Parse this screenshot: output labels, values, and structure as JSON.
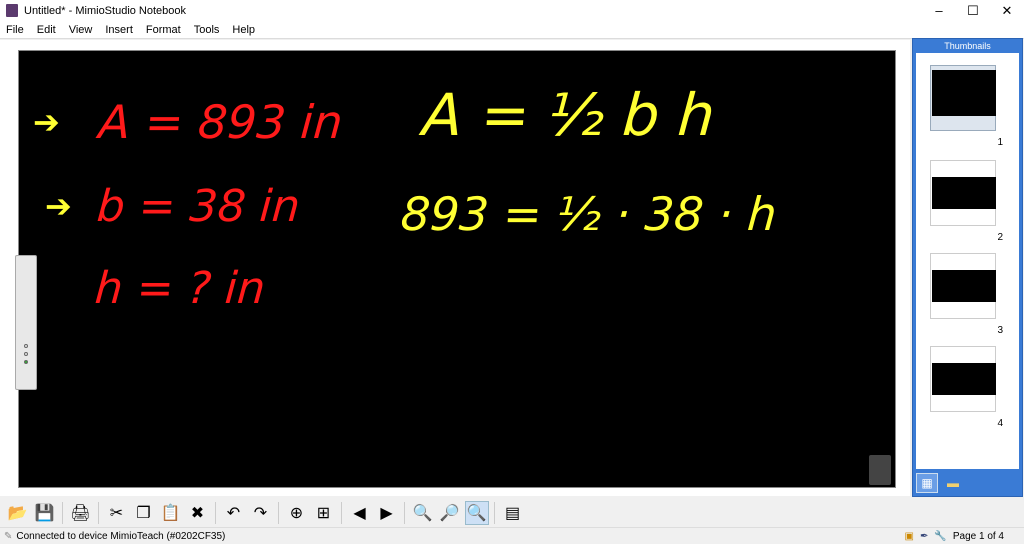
{
  "window": {
    "title": "Untitled* - MimioStudio Notebook",
    "controls": [
      "–",
      "☐",
      "✕"
    ]
  },
  "menu": [
    "File",
    "Edit",
    "View",
    "Insert",
    "Format",
    "Tools",
    "Help"
  ],
  "canvas": {
    "left": [
      {
        "text": "A = 893 in",
        "arrow": true
      },
      {
        "text": "b = 38 in",
        "arrow": true
      },
      {
        "text": "h = ? in",
        "arrow": false
      }
    ],
    "right": [
      "A = ½ b h",
      "893 = ½ · 38 · h"
    ],
    "colors": {
      "red": "#ff1a1a",
      "yellow": "#ffff33"
    }
  },
  "thumbnails": {
    "header": "Thumbnails",
    "pages": [
      "1",
      "2",
      "3",
      "4"
    ],
    "selected": "1"
  },
  "toolbar": [
    {
      "name": "open",
      "glyph": "📂"
    },
    {
      "name": "save",
      "glyph": "💾"
    },
    {
      "sep": true
    },
    {
      "name": "print",
      "glyph": "🖨"
    },
    {
      "sep": true
    },
    {
      "name": "cut",
      "glyph": "✂"
    },
    {
      "name": "copy",
      "glyph": "❐"
    },
    {
      "name": "paste",
      "glyph": "📋"
    },
    {
      "name": "delete",
      "glyph": "✖"
    },
    {
      "sep": true
    },
    {
      "name": "undo",
      "glyph": "↶"
    },
    {
      "name": "redo",
      "glyph": "↷"
    },
    {
      "sep": true
    },
    {
      "name": "new-page",
      "glyph": "⊕"
    },
    {
      "name": "duplicate-page",
      "glyph": "⊞"
    },
    {
      "sep": true
    },
    {
      "name": "previous-page",
      "glyph": "◀"
    },
    {
      "name": "next-page",
      "glyph": "▶"
    },
    {
      "sep": true
    },
    {
      "name": "zoom-in",
      "glyph": "🔍"
    },
    {
      "name": "zoom-out",
      "glyph": "🔎"
    },
    {
      "name": "zoom-fit",
      "glyph": "🔍",
      "active": true
    },
    {
      "sep": true
    },
    {
      "name": "tools",
      "glyph": "▤"
    }
  ],
  "status": {
    "text": "Connected to device MimioTeach (#0202CF35)",
    "page": "Page 1 of 4"
  }
}
